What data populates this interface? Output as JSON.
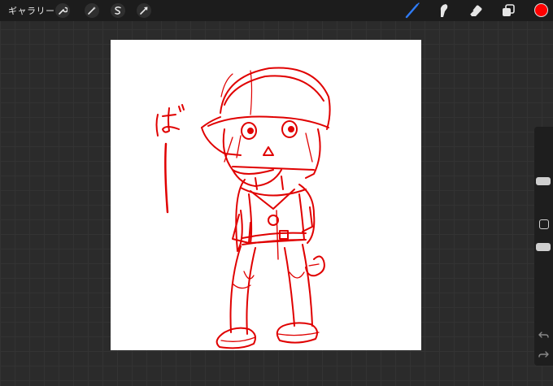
{
  "toolbar": {
    "gallery_label": "ギャラリー",
    "left_tools": [
      {
        "name": "actions",
        "icon": "wrench-icon"
      },
      {
        "name": "adjustments",
        "icon": "magic-wand-icon"
      },
      {
        "name": "selection",
        "icon": "selection-s-icon"
      },
      {
        "name": "transform",
        "icon": "arrow-cursor-icon"
      }
    ],
    "right_tools": [
      {
        "name": "brush",
        "icon": "brush-icon",
        "active": true
      },
      {
        "name": "smudge",
        "icon": "smudge-icon"
      },
      {
        "name": "eraser",
        "icon": "eraser-icon"
      },
      {
        "name": "layers",
        "icon": "layers-icon"
      }
    ],
    "active_tool_color": "#2f7bf5",
    "current_color": "#ff0000"
  },
  "canvas": {
    "background": "#ffffff",
    "stroke_color": "#e00000"
  },
  "sidebar": {
    "brush_size_level": 0.22,
    "opacity_level": 0.5,
    "undo_icon": "undo-icon",
    "redo_icon": "redo-icon"
  }
}
